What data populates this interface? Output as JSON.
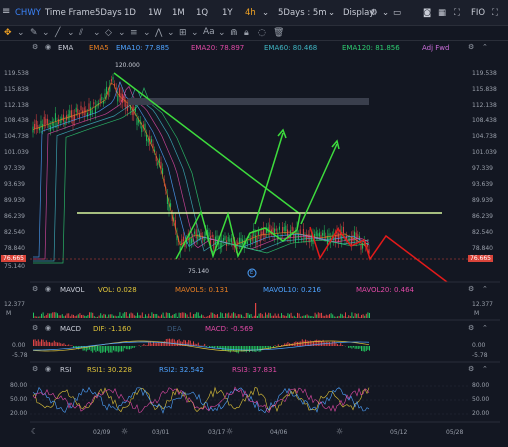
{
  "topbar": {
    "symbol": "CHWY",
    "timeframe_label": "Time Frame",
    "range_items": [
      "5Days",
      "1D",
      "1W",
      "1M",
      "1Q",
      "1Y",
      "4h",
      "5Days : 5m"
    ],
    "active_item": "4h",
    "display_label": "Display",
    "fio_label": "FIO"
  },
  "toolbar2": {
    "text_tool": "Aa"
  },
  "main_legend": {
    "ema_label": "EMA",
    "ema5": "EMA5",
    "ema10": "EMA10: 77.885",
    "ema20": "EMA20: 78.897",
    "ema60": "EMA60: 80.468",
    "ema120": "EMA120: 81.856",
    "adj": "Adj Fwd",
    "colors": {
      "ema5": "#e67e22",
      "ema10": "#4ea3ff",
      "ema20": "#e04aa6",
      "ema60": "#3fb5c2",
      "ema120": "#2ecc71"
    }
  },
  "main_axis": {
    "left_ticks": [
      "119.538",
      "115.838",
      "112.138",
      "108.438",
      "104.738",
      "101.039",
      "97.339",
      "93.639",
      "89.939",
      "86.239",
      "82.540",
      "78.840",
      "75.140"
    ],
    "right_ticks": [
      "119.538",
      "115.838",
      "112.138",
      "108.438",
      "104.738",
      "101.039",
      "97.339",
      "93.639",
      "89.939",
      "86.239",
      "82.540",
      "78.840",
      "75.140"
    ],
    "current_price_left": "76.665",
    "current_price_right": "76.665",
    "high_label": "120.000",
    "low_label": "75.140",
    "marker_label": "E"
  },
  "volume_legend": {
    "label": "MAVOL",
    "vol": "VOL: 0.028",
    "mavol5": "MAVOL5: 0.131",
    "mavol10": "MAVOL10: 0.216",
    "mavol20": "MAVOL20: 0.464",
    "left_max": "12.377",
    "left_unit": "M",
    "right_max": "12.377",
    "right_unit": "M"
  },
  "macd_legend": {
    "label": "MACD",
    "dif": "DIF: -1.160",
    "dea": "DEA",
    "macd": "MACD: -0.569",
    "ticks": [
      "0.00",
      "-5.78"
    ]
  },
  "rsi_legend": {
    "label": "RSI",
    "rsi1": "RSI1: 30.228",
    "rsi2": "RSI2: 32.542",
    "rsi3": "RSI3: 37.831",
    "ticks": [
      "80.00",
      "50.00",
      "20.00"
    ]
  },
  "x_axis": [
    "02/09",
    "03/01",
    "03/17",
    "04/06",
    "05/12",
    "05/28"
  ]
}
